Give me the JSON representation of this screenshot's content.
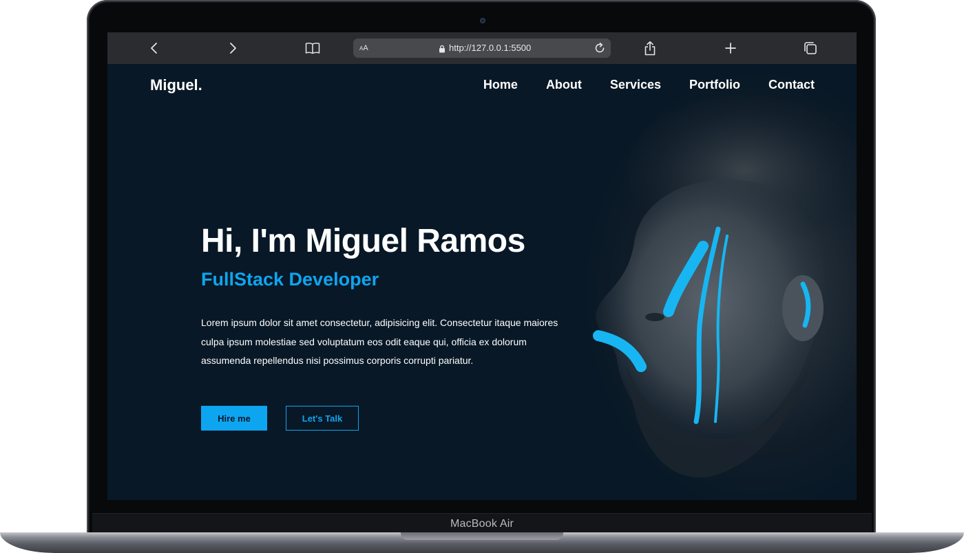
{
  "device": {
    "label": "MacBook Air"
  },
  "browser": {
    "url": "http://127.0.0.1:5500",
    "reader_label_small": "A",
    "reader_label_big": "A"
  },
  "site": {
    "logo": "Miguel.",
    "nav": [
      "Home",
      "About",
      "Services",
      "Portfolio",
      "Contact"
    ]
  },
  "hero": {
    "title": "Hi, I'm Miguel Ramos",
    "subtitle": "FullStack Developer",
    "text": "Lorem ipsum dolor sit amet consectetur, adipisicing elit. Consectetur itaque maiores culpa ipsum molestiae sed voluptatum eos odit eaque qui, officia ex dolorum assumenda repellendus nisi possimus corporis corrupti pariatur.",
    "primary_button": "Hire me",
    "secondary_button": "Let's Talk"
  },
  "colors": {
    "background": "#081826",
    "accent": "#0ea5f0",
    "toolbar": "#2a2c30"
  },
  "icons": {
    "back": "chevron-left-icon",
    "forward": "chevron-right-icon",
    "bookmarks": "book-icon",
    "lock": "lock-icon",
    "reload": "reload-icon",
    "share": "share-icon",
    "new_tab": "plus-icon",
    "tabs": "tabs-icon"
  }
}
